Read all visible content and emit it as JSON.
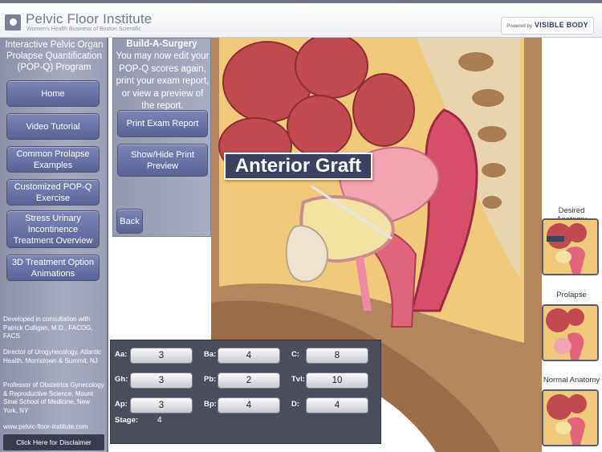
{
  "header": {
    "brand_name": "Pelvic Floor Institute",
    "brand_sub": "Women's Health Business of Boston Scientific",
    "powered_by": "Powered by",
    "powered_brand": "VISIBLE BODY"
  },
  "sidebar": {
    "title": "Interactive Pelvic Organ Prolapse Quantification (POP-Q) Program",
    "nav": [
      {
        "label": "Home"
      },
      {
        "label": "Video Tutorial"
      },
      {
        "label": "Common Prolapse Examples"
      },
      {
        "label": "Customized POP-Q Exercise"
      },
      {
        "label": "Stress Urinary Incontinence Treatment Overview"
      },
      {
        "label": "3D Treatment Option Animations"
      }
    ],
    "credits": [
      "Developed in consultation with Patrick Culligan, M.D., FACOG, FACS",
      "Director of Urogynecology, Atlantic Health, Morristown & Summit, NJ",
      "Professor of Obstetrics Gynecology & Reproductive Science, Mount Sinai School of Medicine, New York, NY",
      "www.pelvic-floor-institute.com"
    ],
    "disclaimer": "Click Here for Disclaimer"
  },
  "surgery_panel": {
    "title": "Build-A-Surgery",
    "text": "You may now edit your POP-Q scores again, print your exam report, or view a preview of the report.",
    "print_label": "Print Exam Report",
    "preview_label": "Show/Hide Print Preview",
    "back_label": "Back"
  },
  "scene": {
    "graft_label": "Anterior Graft"
  },
  "popq": {
    "rows": [
      [
        {
          "label": "Aa:",
          "value": "3"
        },
        {
          "label": "Ba:",
          "value": "4"
        },
        {
          "label": "C:",
          "value": "8"
        }
      ],
      [
        {
          "label": "Gh:",
          "value": "3"
        },
        {
          "label": "Pb:",
          "value": "2"
        },
        {
          "label": "Tvl:",
          "value": "10"
        }
      ],
      [
        {
          "label": "Ap:",
          "value": "3"
        },
        {
          "label": "Bp:",
          "value": "4"
        },
        {
          "label": "D:",
          "value": "4"
        }
      ]
    ],
    "stage_label": "Stage:",
    "stage_value": "4"
  },
  "thumbnails": [
    {
      "label": "Desired Anatomy"
    },
    {
      "label": "Prolapse"
    },
    {
      "label": "Normal Anatomy"
    }
  ]
}
